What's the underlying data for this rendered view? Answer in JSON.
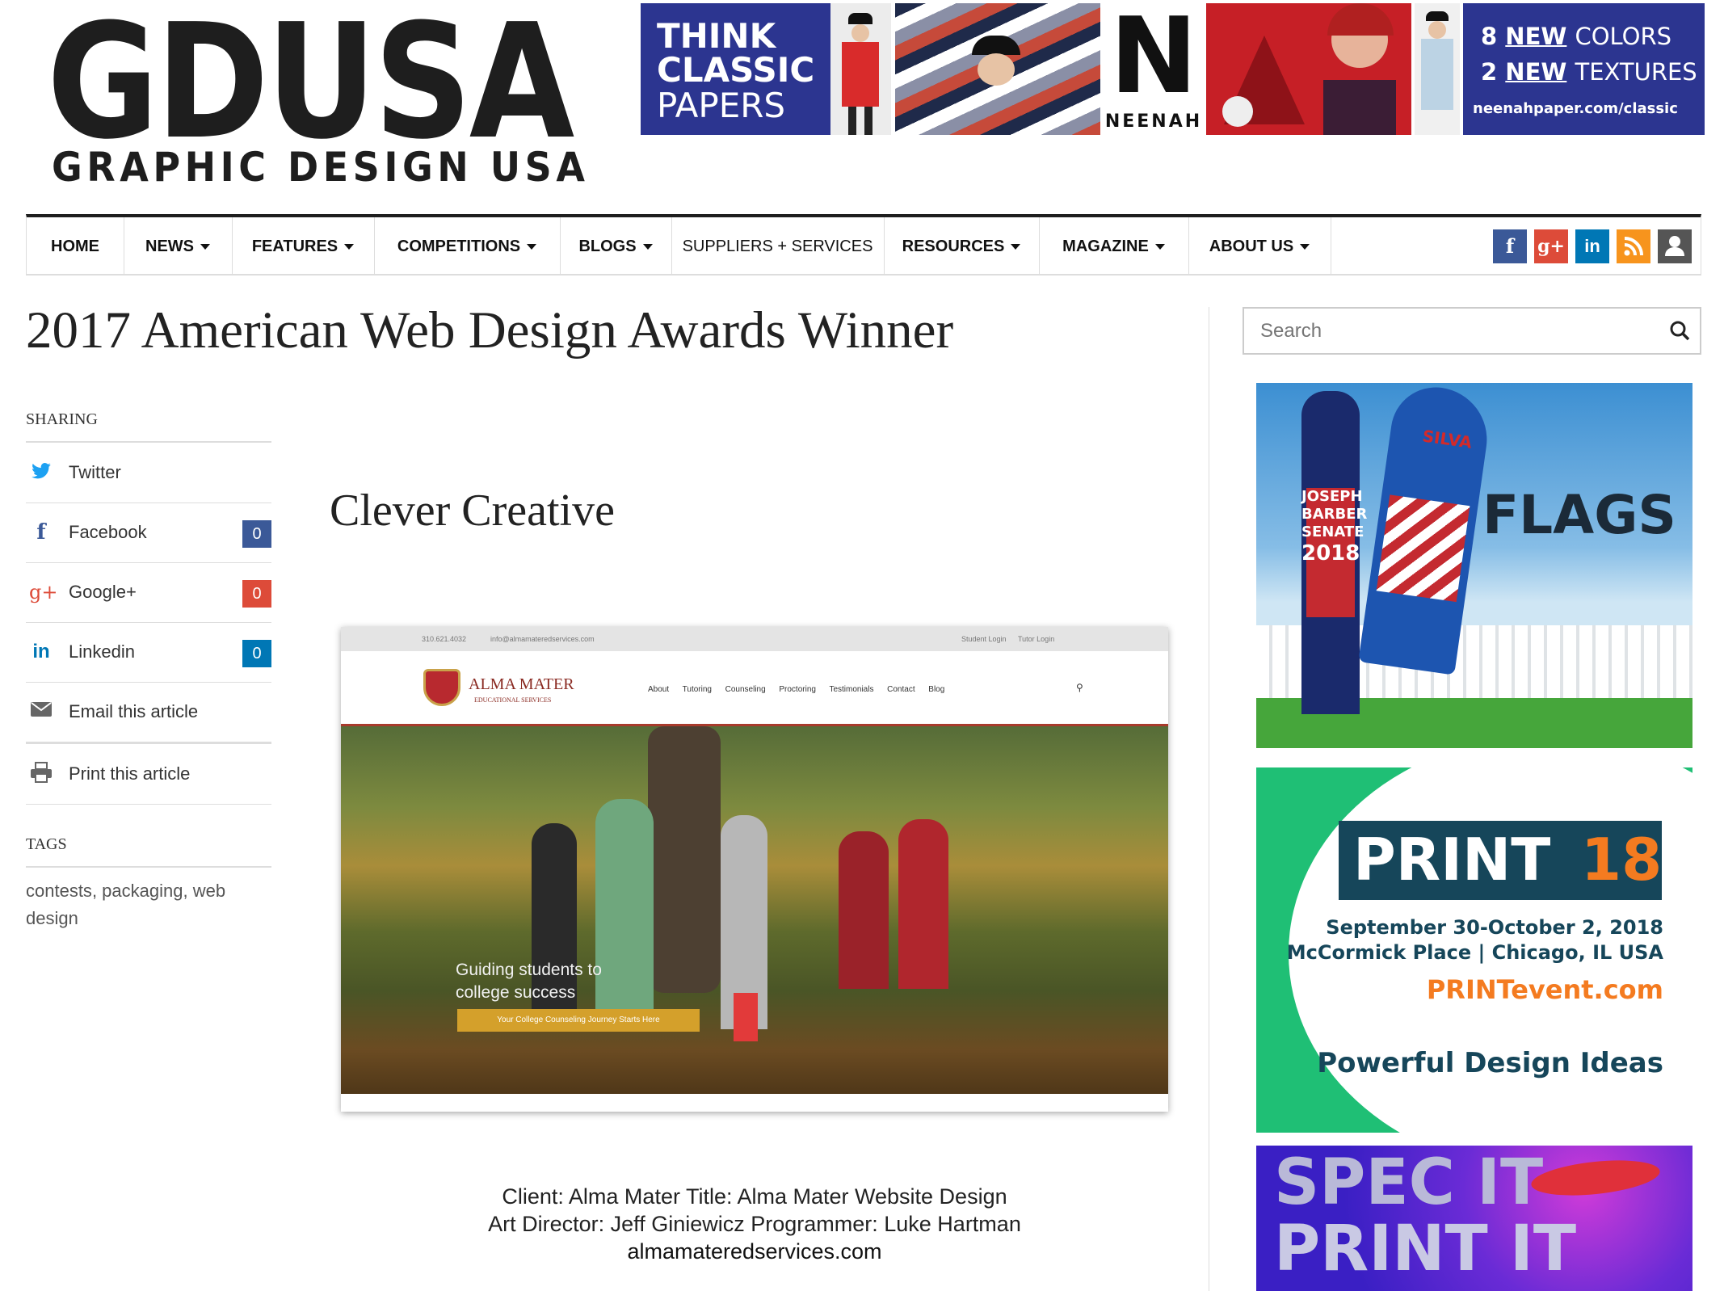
{
  "logo": {
    "main": "GDUSA",
    "sub": "GRAPHIC DESIGN USA"
  },
  "banner": {
    "panel1": [
      "THINK",
      "CLASSIC",
      "PAPERS"
    ],
    "brand": "NEENAH",
    "line1_num": "8",
    "line1_new": "NEW",
    "line1_rest": "COLORS",
    "line2_num": "2",
    "line2_new": "NEW",
    "line2_rest": "TEXTURES",
    "url": "neenahpaper.com/classic"
  },
  "nav": {
    "items": [
      {
        "label": "HOME"
      },
      {
        "label": "NEWS"
      },
      {
        "label": "FEATURES"
      },
      {
        "label": "COMPETITIONS"
      },
      {
        "label": "BLOGS"
      },
      {
        "label": "SUPPLIERS + SERVICES"
      },
      {
        "label": "RESOURCES"
      },
      {
        "label": "MAGAZINE"
      },
      {
        "label": "ABOUT US"
      }
    ],
    "social": [
      {
        "icon": "facebook-icon",
        "glyph": "f",
        "color": "#3b5998"
      },
      {
        "icon": "google-plus-icon",
        "glyph": "g+",
        "color": "#dd4b39"
      },
      {
        "icon": "linkedin-icon",
        "glyph": "in",
        "color": "#0077b5"
      },
      {
        "icon": "rss-icon",
        "glyph": "◣",
        "color": "#f7941d"
      },
      {
        "icon": "user-icon",
        "glyph": "●",
        "color": "#555555"
      }
    ]
  },
  "article": {
    "title": "2017 American Web Design Awards Winner",
    "subtitle": "Clever Creative",
    "caption_line1": "Client: Alma Mater  Title: Alma Mater Website Design",
    "caption_line2": "Art Director: Jeff Giniewicz  Programmer: Luke Hartman",
    "caption_link": "almamateredservices.com"
  },
  "sharing": {
    "heading": "SHARING",
    "items": [
      {
        "label": "Twitter",
        "icon": "twitter-icon",
        "color": "#1da1f2"
      },
      {
        "label": "Facebook",
        "icon": "facebook-icon",
        "color": "#3b5998",
        "count": "0",
        "count_color": "#3b5998"
      },
      {
        "label": "Google+",
        "icon": "google-plus-icon",
        "color": "#dd4b39",
        "count": "0",
        "count_color": "#dd4b39"
      },
      {
        "label": "Linkedin",
        "icon": "linkedin-icon",
        "color": "#0077b5",
        "count": "0",
        "count_color": "#0077b5"
      },
      {
        "label": "Email this article",
        "icon": "envelope-icon",
        "color": "#666666"
      },
      {
        "label": "Print this article",
        "icon": "printer-icon",
        "color": "#666666"
      }
    ]
  },
  "tags": {
    "heading": "TAGS",
    "items": [
      "contests",
      "packaging",
      "web design"
    ]
  },
  "mockup": {
    "topbar_phone": "310.621.4032",
    "topbar_email": "info@almamateredservices.com",
    "student_login": "Student Login",
    "tutor_login": "Tutor Login",
    "logo_title": "ALMA MATER",
    "logo_sub": "EDUCATIONAL SERVICES",
    "menu": [
      "About",
      "Tutoring",
      "Counseling",
      "Proctoring",
      "Testimonials",
      "Contact",
      "Blog"
    ],
    "hero_line1": "Guiding students to",
    "hero_line2": "college success",
    "hero_button": "Your College Counseling Journey Starts Here"
  },
  "sidebar": {
    "search_placeholder": "Search",
    "ad1": {
      "candidate1": "JOSEPH",
      "candidate2": "BARBER",
      "candidate3": "SENATE",
      "candidate4": "2018",
      "flag2": "SILVA",
      "headline": "FLAGS"
    },
    "ad2": {
      "logo_word": "PRINT",
      "logo_num": "18",
      "dates": "September 30-October 2, 2018",
      "venue": "McCormick Place | Chicago, IL USA",
      "url": "PRINTevent.com",
      "tagline": "Powerful Design Ideas"
    },
    "ad3": {
      "line1": "SPEC IT",
      "line2": "PRINT IT"
    }
  }
}
